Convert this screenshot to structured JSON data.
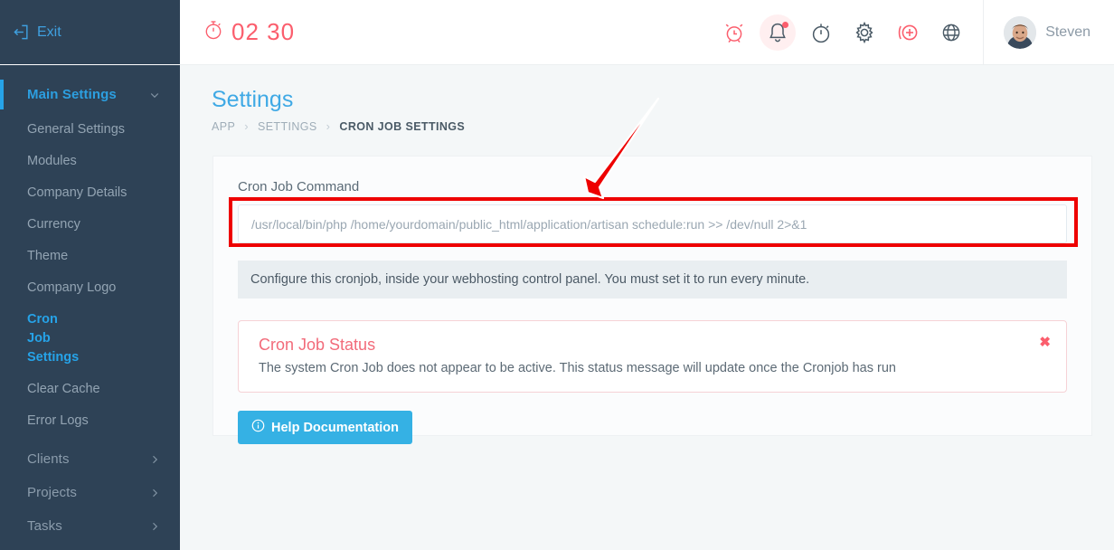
{
  "sidebar": {
    "exit": {
      "label": "Exit",
      "icon": "exit-icon"
    },
    "groups": [
      {
        "label": "Main Settings",
        "icon": "chevron-down-icon",
        "active": true,
        "items": [
          "General Settings",
          "Modules",
          "Company Details",
          "Currency",
          "Theme",
          "Company Logo",
          "Cron Job Settings",
          "Clear Cache",
          "Error Logs"
        ],
        "current": "Cron Job Settings"
      },
      {
        "label": "Clients",
        "icon": "chevron-right-icon",
        "active": false
      },
      {
        "label": "Projects",
        "icon": "chevron-right-icon",
        "active": false
      },
      {
        "label": "Tasks",
        "icon": "chevron-right-icon",
        "active": false
      }
    ]
  },
  "header": {
    "timer": {
      "value": "02 30",
      "icon": "stopwatch-icon"
    },
    "icons": [
      {
        "name": "alarm-clock-icon",
        "color": "#fb5e6d"
      },
      {
        "name": "bell-icon",
        "color": "#4a5a66",
        "badge": true
      },
      {
        "name": "timer-icon",
        "color": "#4a5a66"
      },
      {
        "name": "gear-icon",
        "color": "#4a5a66"
      },
      {
        "name": "plus-circle-icon",
        "color": "#fb5e6d"
      },
      {
        "name": "globe-icon",
        "color": "#4a5a66"
      }
    ],
    "user": {
      "name": "Steven",
      "avatar": "avatar"
    }
  },
  "page": {
    "title": "Settings",
    "breadcrumb": [
      "APP",
      "SETTINGS",
      "CRON JOB SETTINGS"
    ]
  },
  "form": {
    "command_label": "Cron Job Command",
    "command_value": "/usr/local/bin/php /home/yourdomain/public_html/application/artisan schedule:run >> /dev/null 2>&1",
    "command_placeholder": "/usr/local/bin/php /home/yourdomain/public_html/application/artisan schedule:run >> /dev/null 2>&1",
    "note": "Configure this cronjob, inside your webhosting control panel. You must set it to run every minute.",
    "status": {
      "title": "Cron Job Status",
      "message": "The system Cron Job does not appear to be active. This status message will update once the Cronjob has run",
      "close": "✖"
    },
    "help_button": "Help Documentation"
  },
  "annotations": {
    "highlight_color": "#ee0000",
    "arrow_color": "#ee0000"
  }
}
